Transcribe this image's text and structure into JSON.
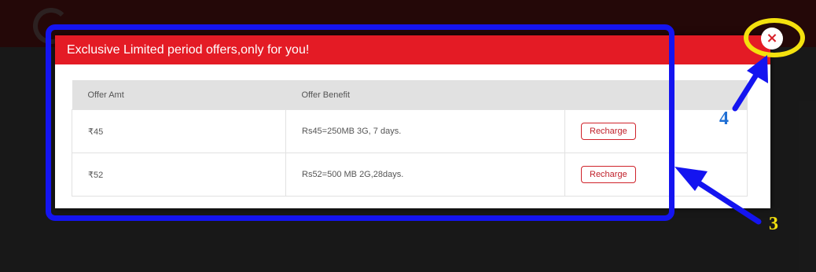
{
  "modal": {
    "title": "Exclusive Limited period offers,only for you!",
    "close_glyph": "×"
  },
  "table": {
    "headers": [
      "Offer Amt",
      "Offer Benefit"
    ],
    "rows": [
      {
        "amount": "₹45",
        "benefit": "Rs45=250MB 3G, 7 days.",
        "action": "Recharge"
      },
      {
        "amount": "₹52",
        "benefit": "Rs52=500 MB 2G,28days.",
        "action": "Recharge"
      }
    ]
  },
  "annotations": {
    "label_4": "4",
    "label_3": "3",
    "rect_color": "#1414f0",
    "highlight_color": "#f4e10e"
  },
  "colors": {
    "header_red": "#e41b25",
    "button_border": "#d0232b"
  }
}
